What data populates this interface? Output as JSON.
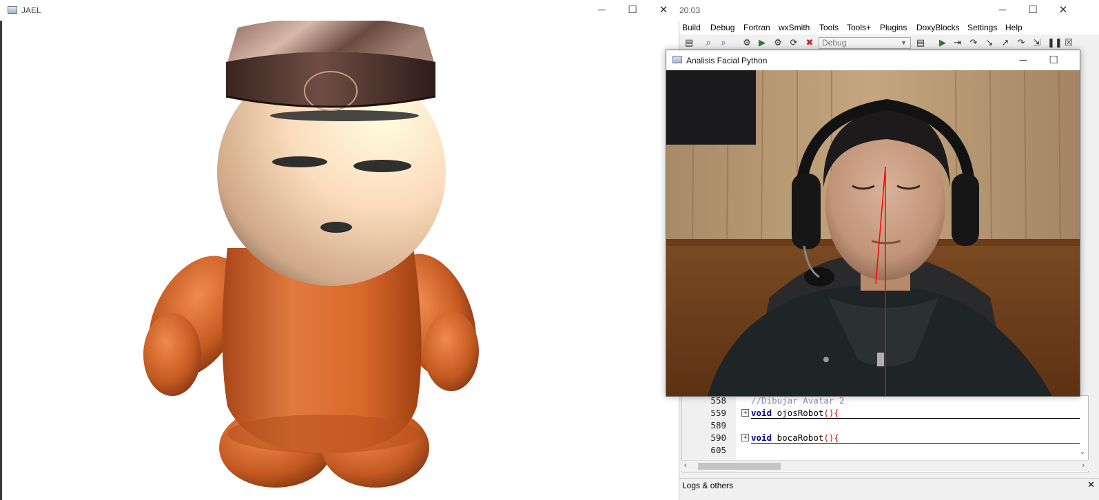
{
  "jael_window": {
    "title": "JAEL",
    "controls": {
      "minimize": "─",
      "maximize": "☐",
      "close": "✕"
    }
  },
  "codeblocks": {
    "title": "20.03",
    "controls": {
      "minimize": "─",
      "maximize": "☐",
      "close": "✕"
    },
    "menu": [
      "Build",
      "Debug",
      "Fortran",
      "wxSmith",
      "Tools",
      "Tools+",
      "Plugins",
      "DoxyBlocks",
      "Settings",
      "Help"
    ],
    "build_target": "Debug",
    "editor": {
      "lines": [
        {
          "num": "558",
          "text": "//Dibujar Avatar 2"
        },
        {
          "num": "559",
          "kw": "void",
          "name": " ojosRobot",
          "paren": "(){"
        },
        {
          "num": "589"
        },
        {
          "num": "590",
          "kw": "void",
          "name": " bocaRobot",
          "paren": "(){"
        },
        {
          "num": "605"
        }
      ]
    },
    "logs_label": "Logs & others",
    "logs_close": "✕"
  },
  "facial_window": {
    "title": "Analisis Facial Python",
    "controls": {
      "minimize": "─",
      "maximize": "☐"
    }
  },
  "colors": {
    "avatar_head": "#f9d2b0",
    "avatar_body": "#d8692a",
    "avatar_hat": "#4a3028",
    "guide_line": "#ff0000"
  }
}
